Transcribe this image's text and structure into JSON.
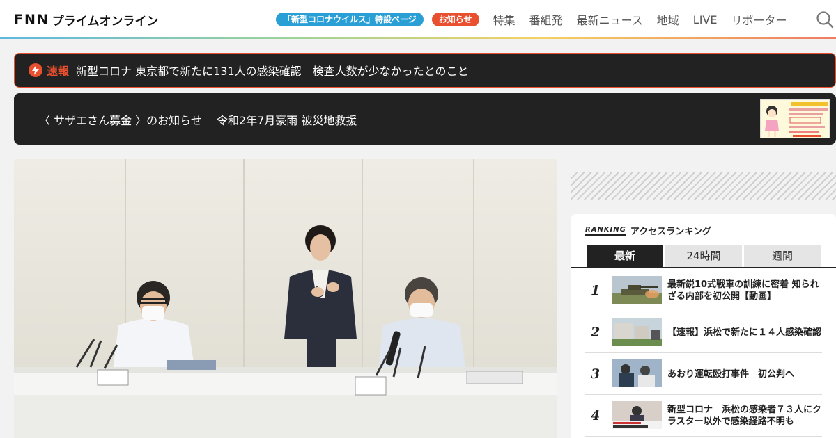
{
  "header": {
    "logo_fnn": "FNN",
    "logo_text": "プライムオンライン",
    "pill_corona": "「新型コロナウイルス」特設ページ",
    "pill_news": "お知らせ",
    "nav": [
      "特集",
      "番組発",
      "最新ニュース",
      "地域",
      "LIVE",
      "リポーター"
    ]
  },
  "breaking": {
    "label": "速報",
    "text": "新型コロナ 東京都で新たに131人の感染確認　検査人数が少なかったとのこと"
  },
  "notice": {
    "text": "〈 サザエさん募金 〉のお知らせ　 令和2年7月豪雨 被災地救援"
  },
  "ranking": {
    "logo": "RANKING",
    "title": "アクセスランキング",
    "tabs": [
      "最新",
      "24時間",
      "週間"
    ],
    "active_tab": "最新",
    "items": [
      {
        "rank": "1",
        "title": "最新鋭10式戦車の訓練に密着 知られざる内部を初公開【動画】"
      },
      {
        "rank": "2",
        "title": "【速報】浜松で新たに１４人感染確認"
      },
      {
        "rank": "3",
        "title": "あおり運転殴打事件　初公判へ"
      },
      {
        "rank": "4",
        "title": "新型コロナ　浜松の感染者７３人にクラスター以外で感染経路不明も"
      }
    ]
  },
  "colors": {
    "accent_blue": "#2a9fd6",
    "accent_orange": "#e8502f",
    "dark_bar": "#222222"
  }
}
